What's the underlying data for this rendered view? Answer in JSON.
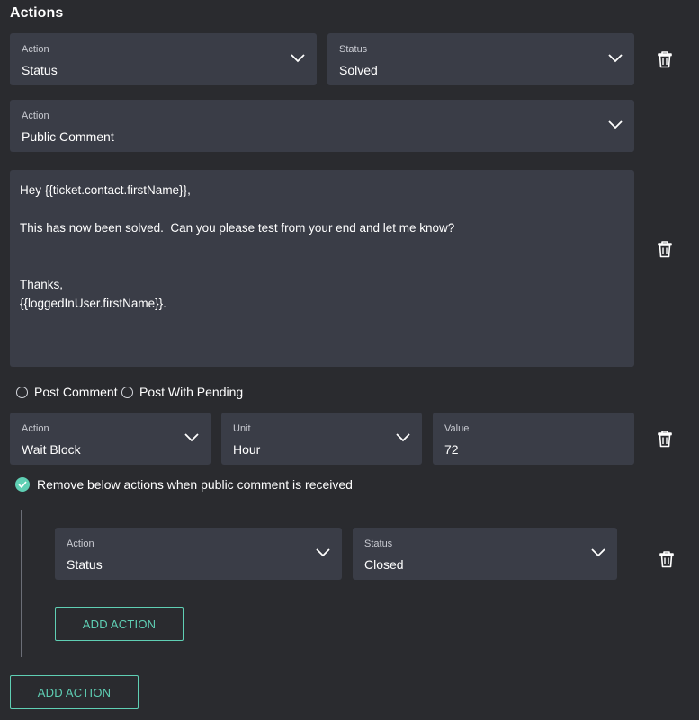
{
  "heading": "Actions",
  "row1": {
    "action": {
      "label": "Action",
      "value": "Status"
    },
    "status": {
      "label": "Status",
      "value": "Solved"
    }
  },
  "row2": {
    "action": {
      "label": "Action",
      "value": "Public Comment"
    },
    "comment": "Hey {{ticket.contact.firstName}},\n\nThis has now been solved.  Can you please test from your end and let me know?\n\n\nThanks,\n{{loggedInUser.firstName}}."
  },
  "radios": {
    "post_comment": "Post Comment",
    "post_with_pending": "Post With Pending"
  },
  "row3": {
    "action": {
      "label": "Action",
      "value": "Wait Block"
    },
    "unit": {
      "label": "Unit",
      "value": "Hour"
    },
    "value": {
      "label": "Value",
      "value": "72"
    }
  },
  "remove_checkbox": {
    "label": "Remove below actions when public comment is received",
    "checked": true
  },
  "nested": {
    "action": {
      "label": "Action",
      "value": "Status"
    },
    "status": {
      "label": "Status",
      "value": "Closed"
    },
    "add_button": "ADD ACTION"
  },
  "add_button": "ADD ACTION",
  "colors": {
    "accent": "#5fcfb4",
    "background": "#2a2b2f",
    "field": "#3a3d47"
  },
  "icons": [
    "chevron-down-icon",
    "trash-icon",
    "check-icon"
  ]
}
